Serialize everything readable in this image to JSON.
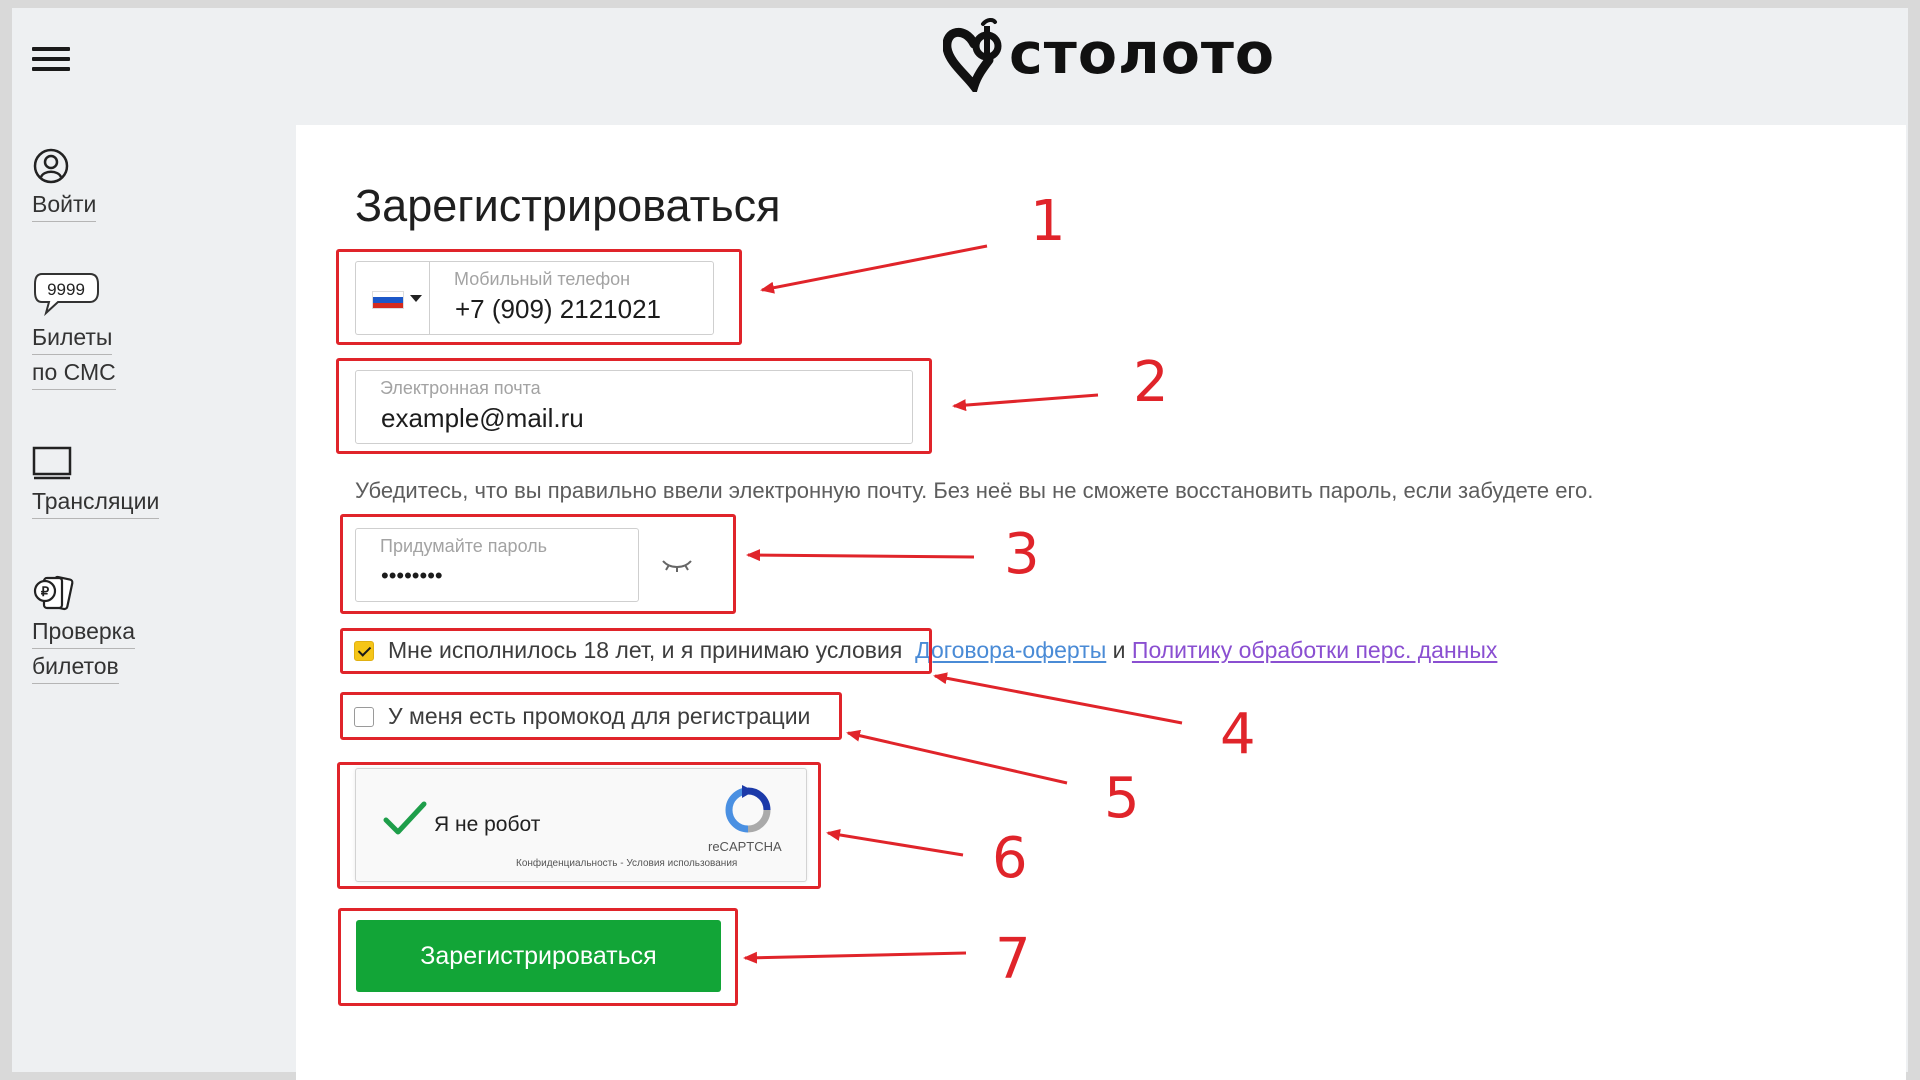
{
  "header": {
    "menu_icon": "hamburger-menu-icon",
    "logo_text": "столото"
  },
  "sidebar": {
    "items": [
      {
        "label": "Войти",
        "icon": "user-circle-icon"
      },
      {
        "label": "Билеты",
        "label2": "по СМС",
        "icon": "sms-bubble-icon",
        "icon_text": "9999"
      },
      {
        "label": "Трансляции",
        "icon": "monitor-icon"
      },
      {
        "label": "Проверка",
        "label2": "билетов",
        "icon": "ticket-check-icon"
      }
    ]
  },
  "form": {
    "title": "Зарегистрироваться",
    "phone": {
      "country": "RU",
      "label": "Мобильный телефон",
      "value": "+7 (909) 2121021"
    },
    "email": {
      "label": "Электронная почта",
      "value": "example@mail.ru"
    },
    "email_hint": "Убедитесь, что вы правильно ввели электронную почту. Без неё вы не сможете восстановить пароль, если забудете его.",
    "password": {
      "label": "Придумайте пароль",
      "value": "••••••••",
      "toggle_icon": "eye-closed-icon"
    },
    "agree": {
      "checked": true,
      "text": "Мне исполнилось 18 лет, и я принимаю условия",
      "link1": "Договора-оферты",
      "and": "и",
      "link2": "Политику обработки перс. данных"
    },
    "promo": {
      "checked": false,
      "text": "У меня есть промокод для регистрации"
    },
    "recaptcha": {
      "label": "Я не робот",
      "brand": "reCAPTCHA",
      "terms": "Конфиденциальность - Условия использования"
    },
    "submit_label": "Зарегистрироваться"
  },
  "annotations": [
    "1",
    "2",
    "3",
    "4",
    "5",
    "6",
    "7"
  ],
  "colors": {
    "accent_green": "#12a537",
    "annotation_red": "#e0242a",
    "checkbox_yellow": "#f5c518",
    "link_blue": "#4a8bd6",
    "link_purple": "#8a4fd1"
  }
}
